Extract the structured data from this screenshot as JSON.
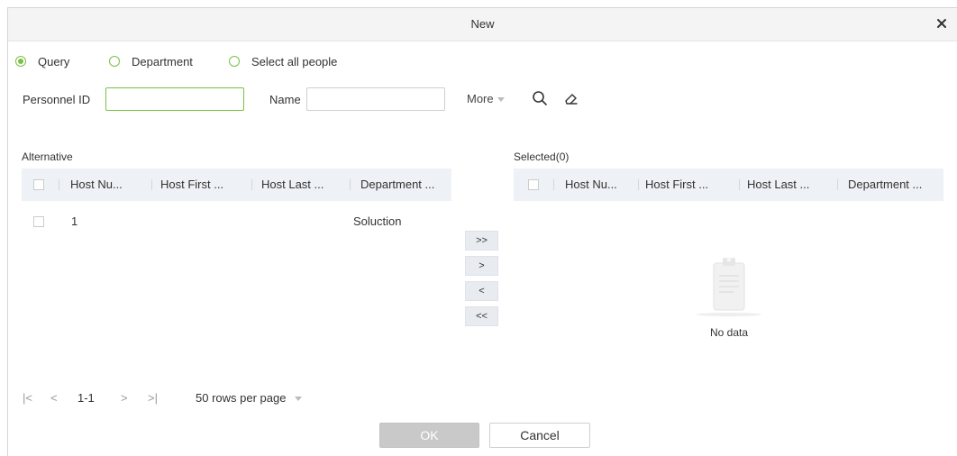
{
  "dialog": {
    "title": "New"
  },
  "mode_options": [
    {
      "label": "Query",
      "selected": true
    },
    {
      "label": "Department",
      "selected": false
    },
    {
      "label": "Select all people",
      "selected": false
    }
  ],
  "search": {
    "personnel_id_label": "Personnel ID",
    "personnel_id_value": "",
    "name_label": "Name",
    "name_value": "",
    "more_label": "More"
  },
  "alternative": {
    "title": "Alternative",
    "columns": [
      "Host Nu...",
      "Host First ...",
      "Host Last ...",
      "Department ..."
    ],
    "rows": [
      {
        "host_number": "1",
        "first_name": "",
        "last_name": "",
        "department": "Soluction"
      }
    ]
  },
  "selected": {
    "title": "Selected(0)",
    "columns": [
      "Host Nu...",
      "Host First ...",
      "Host Last ...",
      "Department ..."
    ],
    "empty_text": "No data"
  },
  "transfer_buttons": {
    "move_all_right": ">>",
    "move_right": ">",
    "move_left": "<",
    "move_all_left": "<<"
  },
  "pagination": {
    "first": "|<",
    "prev": "<",
    "range": "1-1",
    "next": ">",
    "last": ">|",
    "rows_per_page": "50 rows per page"
  },
  "footer": {
    "ok_label": "OK",
    "cancel_label": "Cancel"
  },
  "colors": {
    "accent": "#7ac143",
    "header_bg": "#eef1f5",
    "ok_disabled": "#c9c9c9"
  }
}
